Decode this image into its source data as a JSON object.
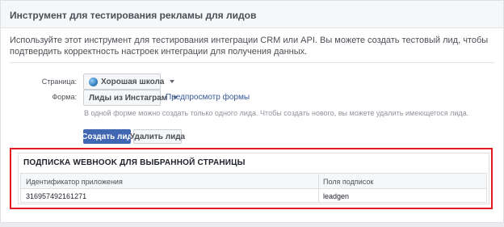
{
  "panel": {
    "title": "Инструмент для тестирования рекламы для лидов"
  },
  "intro": {
    "text": "Используйте этот инструмент для тестирования интеграции CRM или API. Вы можете создать тестовый лид, чтобы подтвердить корректность настроек интеграции для получения данных."
  },
  "page_row": {
    "label": "Страница:",
    "selected": "Хорошая школа"
  },
  "form_row": {
    "label": "Форма:",
    "selected": "Лиды из Инстаграм",
    "preview_link": "Предпросмотр формы",
    "hint": "В одной форме можно создать только одного лида. Чтобы создать нового, вы можете удалить имеющегося лида."
  },
  "actions": {
    "create_label": "Создать лид",
    "delete_label": "Удалить лида"
  },
  "webhook": {
    "title": "ПОДПИСКА WEBHOOK ДЛЯ ВЫБРАННОЙ СТРАНИЦЫ",
    "columns": [
      "Идентификатор приложения",
      "Поля подписок"
    ],
    "rows": [
      [
        "316957492161271",
        "leadgen"
      ]
    ]
  },
  "colors": {
    "primary": "#4267b2",
    "link": "#365899",
    "highlight": "#e41b23"
  },
  "icons": {
    "page_avatar": "page-avatar-icon",
    "dropdown": "chevron-down-icon"
  }
}
